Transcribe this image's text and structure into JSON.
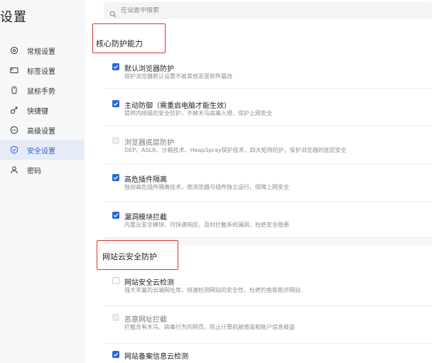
{
  "page_title": "设置",
  "search": {
    "placeholder": "在设置中搜索"
  },
  "nav": [
    {
      "label": "常规设置",
      "icon": "gear-icon",
      "active": false
    },
    {
      "label": "标签设置",
      "icon": "tab-icon",
      "active": false
    },
    {
      "label": "鼠标手势",
      "icon": "mouse-icon",
      "active": false
    },
    {
      "label": "快捷键",
      "icon": "shortcut-icon",
      "active": false
    },
    {
      "label": "高级设置",
      "icon": "advanced-icon",
      "active": false
    },
    {
      "label": "安全设置",
      "icon": "shield-icon",
      "active": true
    },
    {
      "label": "密码",
      "icon": "user-icon",
      "active": false
    }
  ],
  "sections": [
    {
      "heading": "核心防护能力",
      "items": [
        {
          "title": "默认浏览器防护",
          "desc": "保护浏览器默认设置不被其他恶意软件篡改",
          "state": "checked"
        },
        {
          "title": "主动防御（需重启电脑才能生效）",
          "desc": "提供内核级的安全防护，不被木马病毒入侵，保护上网安全",
          "state": "checked"
        },
        {
          "title": "浏览器底层防护",
          "desc": "DEP、ASLR、沙箱技术、HeapSpray保护技术，四大矩阵防护，保护浏览器的底层安全",
          "state": "disabled"
        },
        {
          "title": "高危插件隔离",
          "desc": "独创高危插件隔离技术，使浏览器与插件独立运行，保障上网安全",
          "state": "checked"
        },
        {
          "title": "漏洞模块拦截",
          "desc": "内置云安全模块，可快速响应，及时拦截系统漏洞，杜绝安全隐患",
          "state": "checked"
        }
      ]
    },
    {
      "heading": "网站云安全防护",
      "items": [
        {
          "title": "网站安全云检测",
          "desc": "强大丰富的云端网址库，快速检测网站的安全性，杜绝钓鱼和欺诈网站",
          "state": "unchecked"
        },
        {
          "title": "恶意网址拦截",
          "desc": "拦截含有木马、病毒行为的网页，防止计算机被感染和账户信息被盗",
          "state": "disabled"
        },
        {
          "title": "网站备案信息云检测",
          "desc": "",
          "state": "checked"
        }
      ]
    }
  ],
  "colors": {
    "accent": "#2a67d8",
    "highlight_box": "#e0322d",
    "active_nav_bg": "#e5ecf8"
  }
}
